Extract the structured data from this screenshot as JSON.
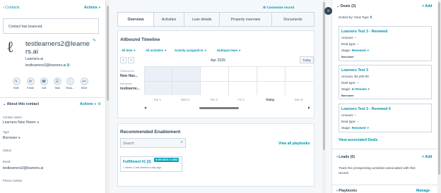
{
  "left": {
    "contacts_link": "Contacts",
    "actions_label": "Actions",
    "bounced_alert": "Contact has bounced.",
    "contact_name_line1": "testlearners2@learne",
    "contact_name_line2": "rs.ai",
    "company": "Learners.ai",
    "email": "testlearners2@learners.ai",
    "action_buttons": [
      "Note",
      "Email",
      "Call",
      "Task",
      "Sequ...",
      "More"
    ],
    "about_title": "About this contact",
    "about_actions": "Actions",
    "fields": {
      "owner_label": "Contact owner",
      "owner_value": "Learners New Haven",
      "type_label": "Type",
      "type_value": "Borrower",
      "status_label": "Status",
      "email_label": "Email",
      "email_value": "testlearners2@learners.ai",
      "phone_label": "Phone number"
    }
  },
  "middle": {
    "customize_label": "Customize record",
    "tabs": [
      "Overview",
      "Activities",
      "Loan details",
      "Property overview",
      "Documents"
    ],
    "timeline_title": "Allbound Timeline",
    "filters": [
      "All time",
      "All activities",
      "Activity assigned to",
      "HubSpot team"
    ],
    "month": "Apr 2025",
    "today_button": "Today",
    "rows": [
      {
        "top": "Outbounds",
        "bottom": "New Hav..."
      },
      {
        "top": "Inbounds",
        "bottom": "testlearne..."
      }
    ],
    "days": [
      "Tue 1",
      "Wed 2",
      "Thu 3",
      "Fri 4",
      "Today",
      "Sun 6"
    ],
    "enablement_title": "Recommended Enablement",
    "search_placeholder": "Search",
    "view_playbooks": "View all playbooks",
    "playbook": {
      "title": "Fulfillment #1 (2)",
      "badge": "RECENTLY USED",
      "meta": "1 views • Last viewed a day ago"
    }
  },
  "right": {
    "deals_title": "Deals (3)",
    "add_label": "+ Add",
    "sorted_by": "Sorted by: Deal Type",
    "deals": [
      {
        "title": "Learners Test 3 - Renewed",
        "amount": "Amount: --",
        "type": "Deal type: --",
        "stage_label": "Stage:",
        "stage": "Renewed",
        "extra": "Borrower"
      },
      {
        "title": "Learners Test 3",
        "amount": "Amount: $3,200.00",
        "type": "Deal type: --",
        "stage_label": "Stage:",
        "stage": "In Review",
        "extra": "Borrower"
      },
      {
        "title": "Learners Test 3 - Renewed 4",
        "amount": "Amount: --",
        "type": "Deal type: --",
        "stage_label": "Stage:",
        "stage": "Renewed",
        "extra": ""
      }
    ],
    "view_associated": "View associated Deals",
    "leads_title": "Leads (0)",
    "leads_add": "+ Add",
    "leads_desc_1": "Track the prospecting activities associated with this",
    "leads_desc_2": "record.",
    "playbooks_title": "Playbooks",
    "playbooks_manage": "Manage"
  }
}
